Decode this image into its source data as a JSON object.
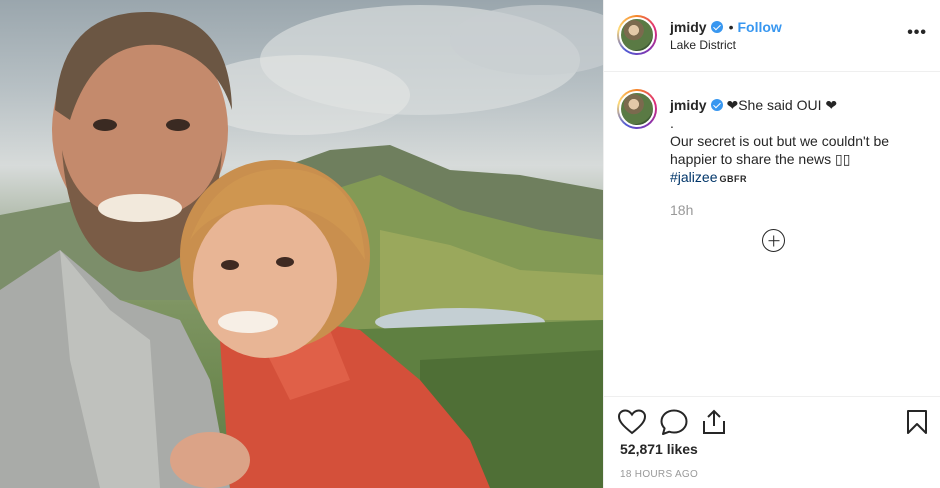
{
  "post": {
    "username": "jmidy",
    "separator": "•",
    "follow_label": "Follow",
    "location": "Lake District",
    "more_label": "•••"
  },
  "caption": {
    "username": "jmidy",
    "headline": "❤She said OUI ❤",
    "dot_line": ".",
    "body_line1": "Our secret is out but we couldn't be",
    "body_line2": "happier to share the news ▯▯",
    "hashtag": "#jalizee",
    "flag_text": "GBFR",
    "time": "18h"
  },
  "stats": {
    "likes": "52,871 likes",
    "posted": "18 HOURS AGO"
  },
  "icons": {
    "like": "heart-icon",
    "comment": "comment-icon",
    "share": "share-icon",
    "save": "bookmark-icon",
    "verified": "verified-badge-icon",
    "load_more": "plus-circle-icon"
  },
  "colors": {
    "accent": "#3897f0",
    "text": "#262626",
    "muted": "#999999",
    "hashtag": "#003569",
    "sweater": "#d4503a"
  }
}
